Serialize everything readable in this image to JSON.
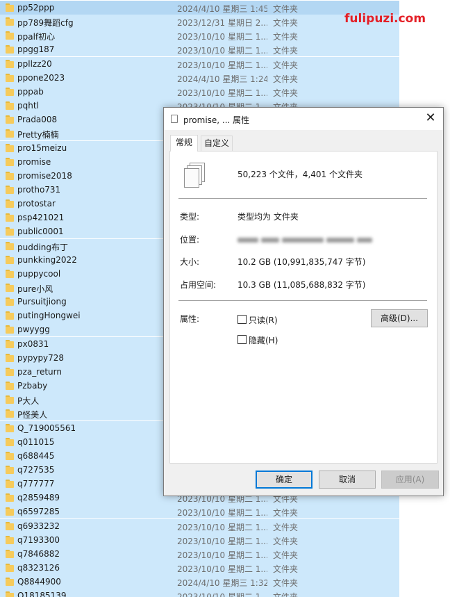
{
  "watermark": "fulipuzi.com",
  "files": [
    {
      "name": "pp52ppp",
      "date": "2024/4/10 星期三 1:45",
      "type": "文件夹"
    },
    {
      "name": "pp789舞蹈cfg",
      "date": "2023/12/31 星期日 2...",
      "type": "文件夹"
    },
    {
      "name": "ppalf初心",
      "date": "2023/10/10 星期二 1...",
      "type": "文件夹"
    },
    {
      "name": "ppgg187",
      "date": "2023/10/10 星期二 1...",
      "type": "文件夹"
    },
    {
      "name": "ppllzz20",
      "date": "2023/10/10 星期二 1...",
      "type": "文件夹"
    },
    {
      "name": "ppone2023",
      "date": "2024/4/10 星期三 1:24",
      "type": "文件夹"
    },
    {
      "name": "pppab",
      "date": "2023/10/10 星期二 1...",
      "type": "文件夹"
    },
    {
      "name": "pqhtl",
      "date": "2023/10/10 星期二 1...",
      "type": "文件夹"
    },
    {
      "name": "Prada008",
      "date": "",
      "type": ""
    },
    {
      "name": "Pretty楠楠",
      "date": "",
      "type": ""
    },
    {
      "name": "pro15meizu",
      "date": "",
      "type": ""
    },
    {
      "name": "promise",
      "date": "",
      "type": ""
    },
    {
      "name": "promise2018",
      "date": "",
      "type": ""
    },
    {
      "name": "protho731",
      "date": "",
      "type": ""
    },
    {
      "name": "protostar",
      "date": "",
      "type": ""
    },
    {
      "name": "psp421021",
      "date": "",
      "type": ""
    },
    {
      "name": "public0001",
      "date": "",
      "type": ""
    },
    {
      "name": "pudding布丁",
      "date": "",
      "type": ""
    },
    {
      "name": "punkking2022",
      "date": "",
      "type": ""
    },
    {
      "name": "puppycool",
      "date": "",
      "type": ""
    },
    {
      "name": "pure小风",
      "date": "",
      "type": ""
    },
    {
      "name": "Pursuitjiong",
      "date": "",
      "type": ""
    },
    {
      "name": "putingHongwei",
      "date": "",
      "type": ""
    },
    {
      "name": "pwyygg",
      "date": "",
      "type": ""
    },
    {
      "name": "px0831",
      "date": "",
      "type": ""
    },
    {
      "name": "pypypy728",
      "date": "",
      "type": ""
    },
    {
      "name": "pza_return",
      "date": "",
      "type": ""
    },
    {
      "name": "Pzbaby",
      "date": "",
      "type": ""
    },
    {
      "name": "P大人",
      "date": "",
      "type": ""
    },
    {
      "name": "P怪美人",
      "date": "",
      "type": ""
    },
    {
      "name": "Q_719005561",
      "date": "",
      "type": ""
    },
    {
      "name": "q011015",
      "date": "",
      "type": ""
    },
    {
      "name": "q688445",
      "date": "",
      "type": ""
    },
    {
      "name": "q727535",
      "date": "",
      "type": ""
    },
    {
      "name": "q777777",
      "date": "",
      "type": ""
    },
    {
      "name": "q2859489",
      "date": "2023/10/10 星期二 1...",
      "type": "文件夹"
    },
    {
      "name": "q6597285",
      "date": "2023/10/10 星期二 1...",
      "type": "文件夹"
    },
    {
      "name": "q6933232",
      "date": "2023/10/10 星期二 1...",
      "type": "文件夹"
    },
    {
      "name": "q7193300",
      "date": "2023/10/10 星期二 1...",
      "type": "文件夹"
    },
    {
      "name": "q7846882",
      "date": "2023/10/10 星期二 1...",
      "type": "文件夹"
    },
    {
      "name": "q8323126",
      "date": "2023/10/10 星期二 1...",
      "type": "文件夹"
    },
    {
      "name": "Q8844900",
      "date": "2024/4/10 星期三 1:32",
      "type": "文件夹"
    },
    {
      "name": "Q18185139",
      "date": "2023/10/10 星期二 1...",
      "type": "文件夹"
    }
  ],
  "dialog": {
    "title": "promise, ... 属性",
    "close": "✕",
    "tabs": {
      "general": "常规",
      "custom": "自定义"
    },
    "summary": "50,223 个文件，4,401 个文件夹",
    "type_label": "类型:",
    "type_value": "类型均为 文件夹",
    "location_label": "位置:",
    "size_label": "大小:",
    "size_value": "10.2 GB (10,991,835,747 字节)",
    "disk_label": "占用空间:",
    "disk_value": "10.3 GB (11,085,688,832 字节)",
    "attr_label": "属性:",
    "readonly_label": "只读(R)",
    "hidden_label": "隐藏(H)",
    "advanced_button": "高级(D)...",
    "ok_button": "确定",
    "cancel_button": "取消",
    "apply_button": "应用(A)"
  },
  "colors": {
    "selection": "#cde8fb",
    "watermark": "#e41f26",
    "folder": "#f6cb5c",
    "accent": "#0078d7"
  }
}
